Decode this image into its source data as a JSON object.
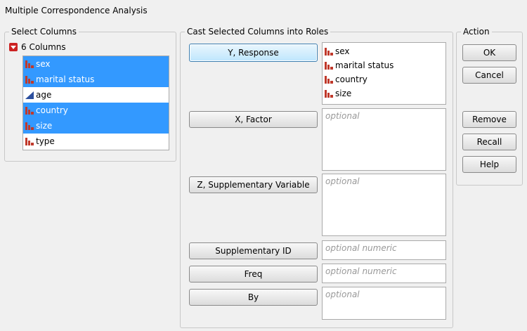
{
  "window": {
    "title": "Multiple Correspondence Analysis"
  },
  "select_columns": {
    "group_label": "Select Columns",
    "count_label": "6 Columns",
    "columns": [
      {
        "label": "sex",
        "selected": true,
        "icon": "nominal-bar-icon"
      },
      {
        "label": "marital status",
        "selected": true,
        "icon": "nominal-bar-icon"
      },
      {
        "label": "age",
        "selected": false,
        "icon": "continuous-triangle-icon"
      },
      {
        "label": "country",
        "selected": true,
        "icon": "nominal-bar-icon"
      },
      {
        "label": "size",
        "selected": true,
        "icon": "nominal-bar-icon"
      },
      {
        "label": "type",
        "selected": false,
        "icon": "nominal-bar-icon"
      }
    ]
  },
  "roles": {
    "group_label": "Cast Selected Columns into Roles",
    "y": {
      "button": "Y, Response",
      "items": [
        "sex",
        "marital status",
        "country",
        "size"
      ]
    },
    "x": {
      "button": "X, Factor",
      "placeholder": "optional"
    },
    "z": {
      "button": "Z, Supplementary Variable",
      "placeholder": "optional"
    },
    "supp_id": {
      "button": "Supplementary ID",
      "placeholder": "optional numeric"
    },
    "freq": {
      "button": "Freq",
      "placeholder": "optional numeric"
    },
    "by": {
      "button": "By",
      "placeholder": "optional"
    }
  },
  "action": {
    "group_label": "Action",
    "ok": "OK",
    "cancel": "Cancel",
    "remove": "Remove",
    "recall": "Recall",
    "help": "Help"
  },
  "colors": {
    "selection": "#3399ff",
    "nominal_icon": "#c0392b",
    "continuous_icon": "#2c4f9e"
  }
}
